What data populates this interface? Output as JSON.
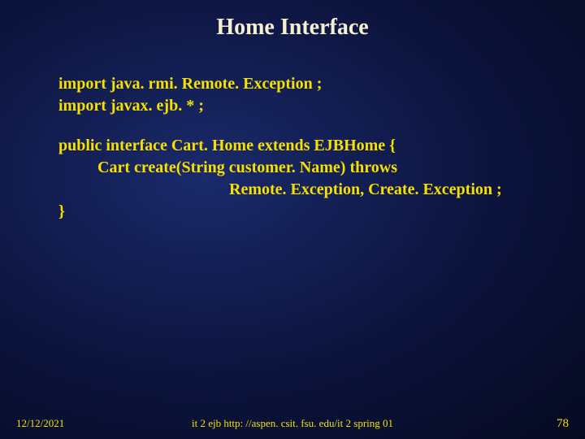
{
  "title": "Home Interface",
  "code": {
    "line1": "import java. rmi. Remote. Exception ;",
    "line2": "import javax. ejb. * ;",
    "line3": "public interface Cart. Home extends EJBHome {",
    "line4": "Cart create(String customer. Name) throws",
    "line5": "Remote. Exception, Create. Exception ;",
    "line6": "}"
  },
  "footer": {
    "date": "12/12/2021",
    "source": "it 2 ejb  http: //aspen. csit. fsu. edu/it 2 spring 01",
    "page": "78"
  }
}
